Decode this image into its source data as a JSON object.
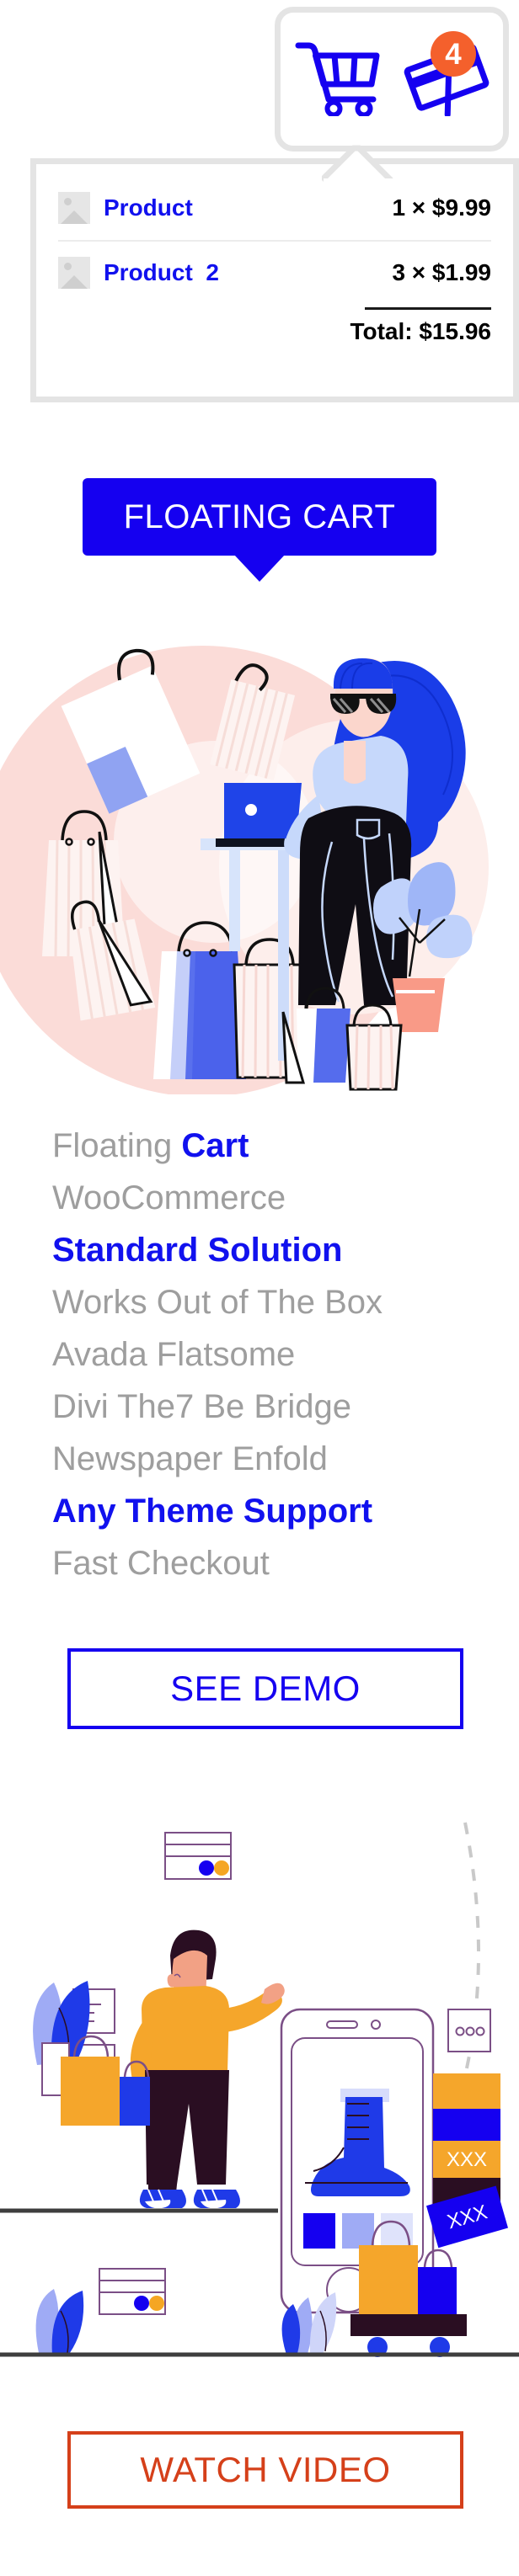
{
  "colors": {
    "brand_blue": "#1500f0",
    "link_blue": "#1111ee",
    "badge_orange": "#f4602c",
    "grey_text": "#9e9e9e",
    "panel_border": "#e4e4e4",
    "video_red": "#d5401a",
    "pink_blob": "#fbdcd8"
  },
  "cart_widget": {
    "badge_count": "4",
    "cart_icon": "shopping-cart-icon",
    "card_icon": "credit-card-icon",
    "items": [
      {
        "thumb": "image-placeholder-icon",
        "name": "Product",
        "price": "1 × $9.99"
      },
      {
        "thumb": "image-placeholder-icon",
        "name": "Product  2",
        "price": "3 × $1.99"
      }
    ],
    "total": "Total: $15.96"
  },
  "banner": {
    "label": "FLOATING CART"
  },
  "features": [
    {
      "parts": [
        {
          "text": "Floating ",
          "style": "grey"
        },
        {
          "text": "Cart",
          "style": "blue"
        }
      ]
    },
    {
      "parts": [
        {
          "text": "WooCommerce",
          "style": "grey"
        }
      ]
    },
    {
      "parts": [
        {
          "text": "Standard Solution",
          "style": "blue"
        }
      ]
    },
    {
      "parts": [
        {
          "text": "Works Out of The Box",
          "style": "grey"
        }
      ]
    },
    {
      "parts": [
        {
          "text": "Avada Flatsome",
          "style": "grey"
        }
      ]
    },
    {
      "parts": [
        {
          "text": "Divi The7 Be Bridge",
          "style": "grey"
        }
      ]
    },
    {
      "parts": [
        {
          "text": "Newspaper Enfold",
          "style": "grey"
        }
      ]
    },
    {
      "parts": [
        {
          "text": "Any Theme Support",
          "style": "blue"
        }
      ]
    },
    {
      "parts": [
        {
          "text": "Fast Checkout",
          "style": "grey"
        }
      ]
    }
  ],
  "see_demo": {
    "label": "SEE DEMO"
  },
  "watch_video": {
    "label": "WATCH VIDEO"
  },
  "illustration_one": {
    "alt": "woman-with-laptop-and-shopping-bags-illustration"
  },
  "illustration_two": {
    "alt": "man-shopping-on-phone-illustration"
  }
}
